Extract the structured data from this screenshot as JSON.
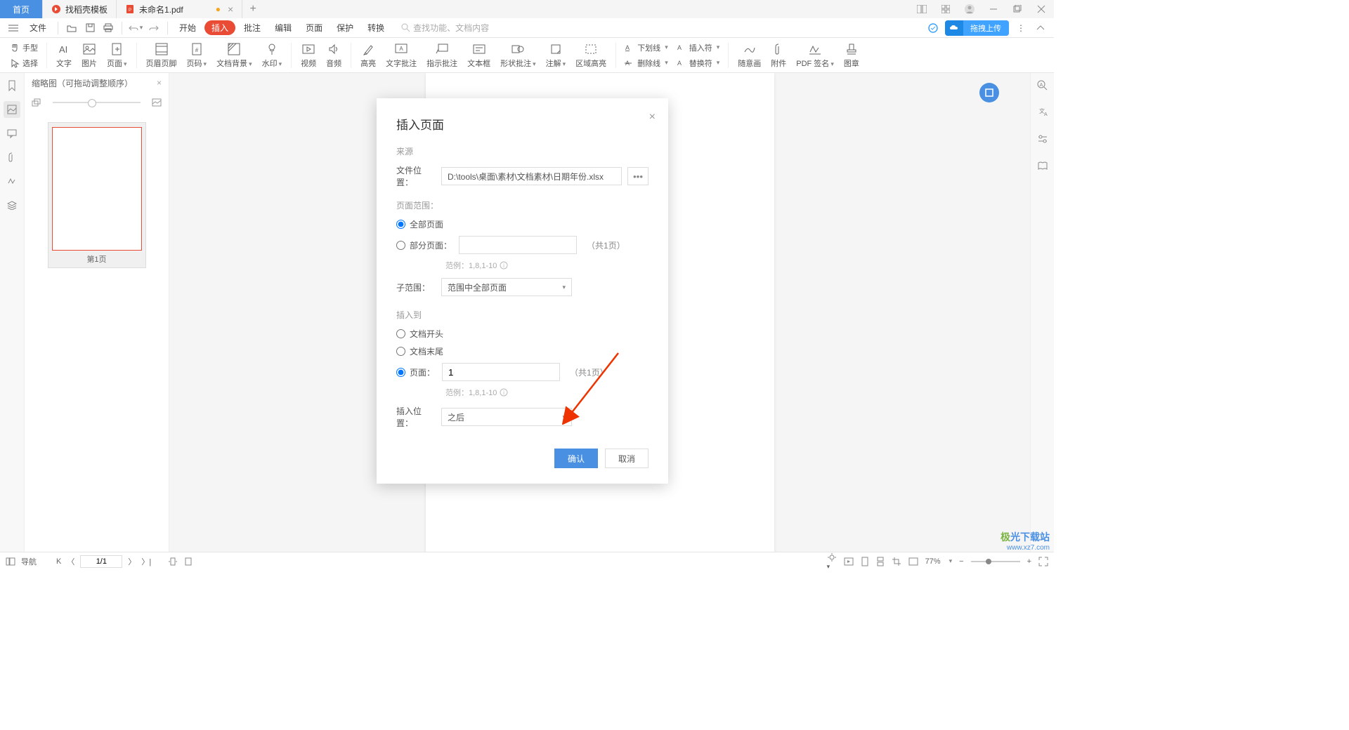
{
  "titlebar": {
    "home": "首页",
    "template": "找稻壳模板",
    "doc": "未命名1.pdf",
    "modified": "●"
  },
  "menubar": {
    "file": "文件",
    "start": "开始",
    "insert": "插入",
    "annotate": "批注",
    "edit": "编辑",
    "page": "页面",
    "protect": "保护",
    "convert": "转换",
    "search_ph": "查找功能、文档内容",
    "upload": "拖拽上传"
  },
  "ribbon_left": {
    "hand": "手型",
    "select": "选择"
  },
  "ribbon": [
    {
      "label": "文字",
      "dd": false
    },
    {
      "label": "图片",
      "dd": false
    },
    {
      "label": "页面",
      "dd": true
    },
    {
      "label": "页眉页脚",
      "dd": false
    },
    {
      "label": "页码",
      "dd": true
    },
    {
      "label": "文档背景",
      "dd": true
    },
    {
      "label": "水印",
      "dd": true
    },
    {
      "label": "视频",
      "dd": false
    },
    {
      "label": "音频",
      "dd": false
    },
    {
      "label": "高亮",
      "dd": false
    },
    {
      "label": "文字批注",
      "dd": false
    },
    {
      "label": "指示批注",
      "dd": false
    },
    {
      "label": "文本框",
      "dd": false
    },
    {
      "label": "形状批注",
      "dd": true
    },
    {
      "label": "注解",
      "dd": true
    },
    {
      "label": "区域高亮",
      "dd": false
    }
  ],
  "ribbon_text": {
    "underline": "下划线",
    "strike": "删除线",
    "insert_sym": "插入符",
    "replace_sym": "替换符"
  },
  "ribbon_right": [
    {
      "label": "随意画"
    },
    {
      "label": "附件"
    },
    {
      "label": "PDF 签名"
    },
    {
      "label": "图章"
    }
  ],
  "thumb": {
    "title": "缩略图（可拖动调整顺序）",
    "page1": "第1页"
  },
  "dialog": {
    "title": "插入页面",
    "source": "来源",
    "file_loc": "文件位置：",
    "file_path": "D:\\tools\\桌面\\素材\\文档素材\\日期年份.xlsx",
    "page_range": "页面范围：",
    "all_pages": "全部页面",
    "partial_pages": "部分页面：",
    "count1": "（共1页）",
    "hint": "范例：1,8,1-10",
    "sub_range": "子范围：",
    "sub_range_val": "范围中全部页面",
    "insert_to": "插入到",
    "doc_start": "文档开头",
    "doc_end": "文档末尾",
    "page_label": "页面：",
    "page_val": "1",
    "count2": "（共1页）",
    "insert_pos": "插入位置：",
    "insert_pos_val": "之后",
    "ok": "确认",
    "cancel": "取消"
  },
  "status": {
    "nav": "导航",
    "page": "1/1",
    "zoom": "77%"
  },
  "watermark": {
    "line1": "极光下载站",
    "line2": "www.xz7.com"
  }
}
